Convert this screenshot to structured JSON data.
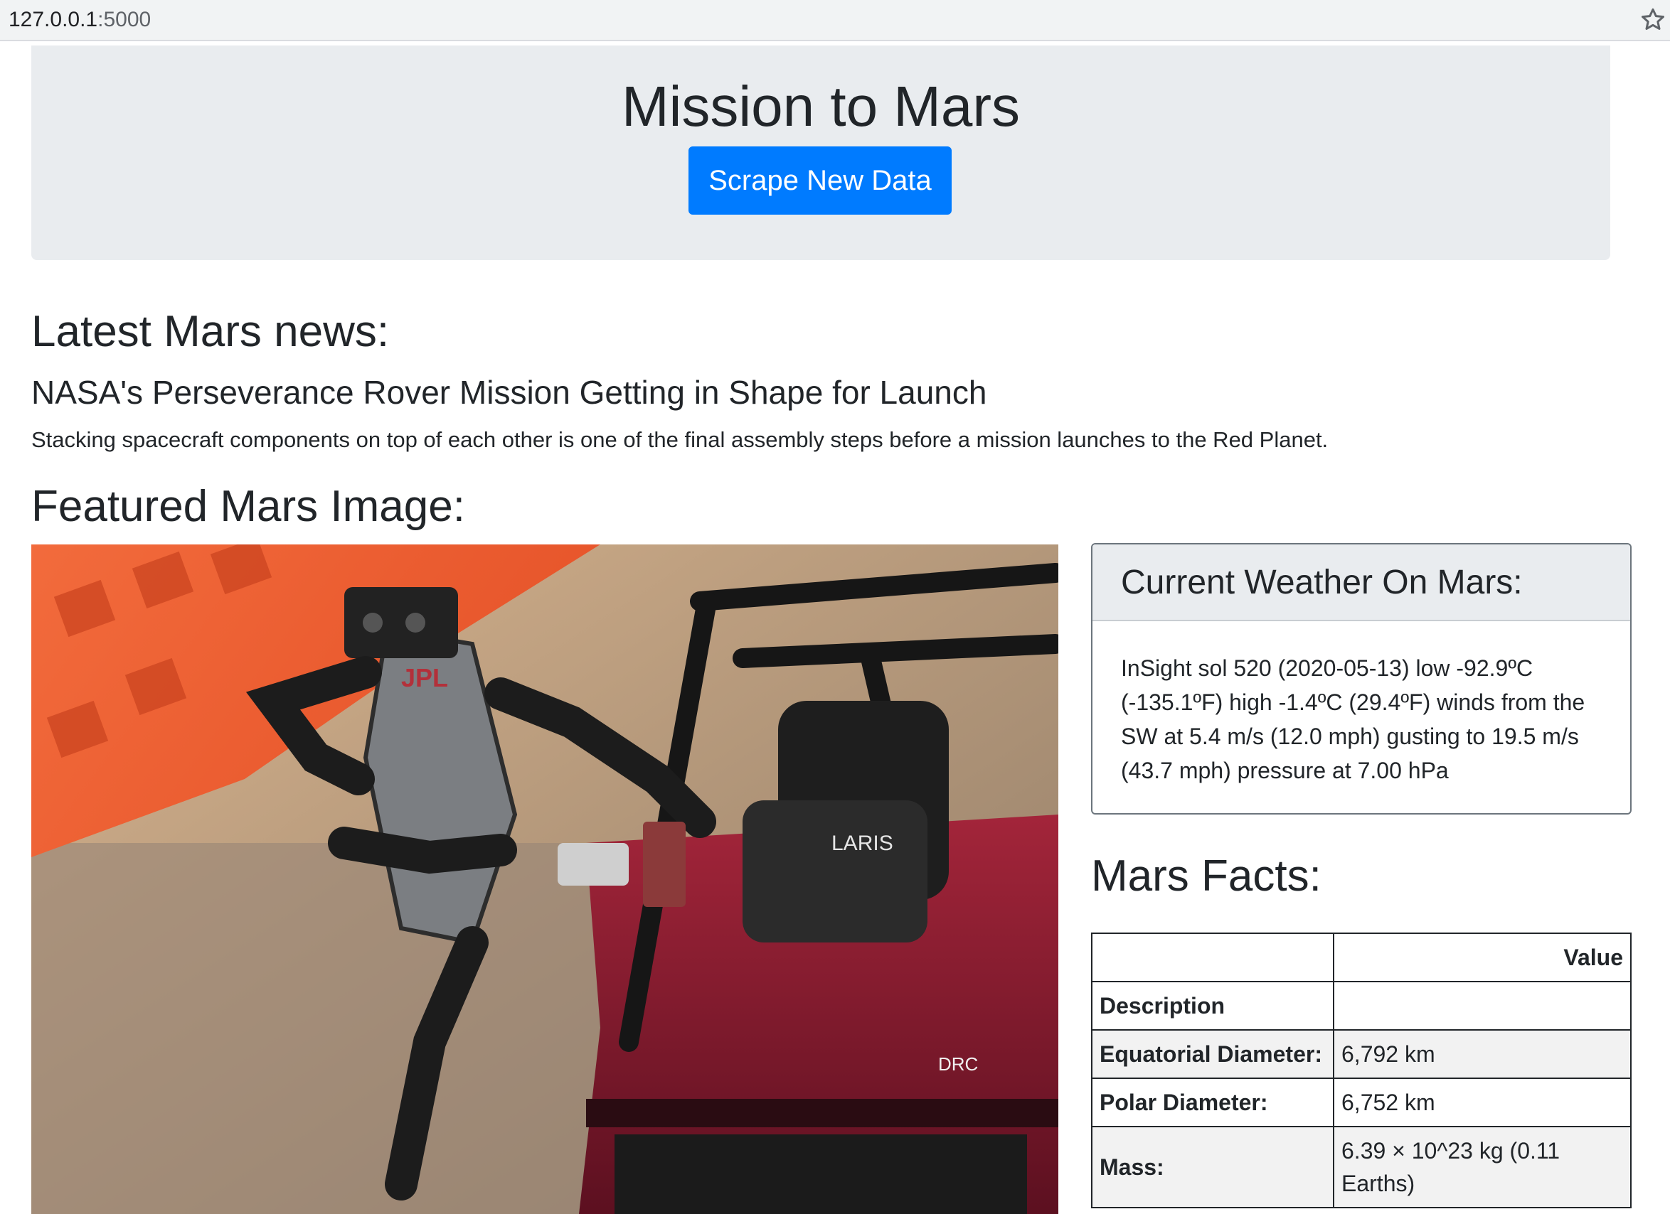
{
  "browser": {
    "url_host": "127.0.0.1",
    "url_port": ":5000"
  },
  "jumbotron": {
    "title": "Mission to Mars",
    "button_label": "Scrape New Data"
  },
  "news": {
    "heading": "Latest Mars news:",
    "title": "NASA's Perseverance Rover Mission Getting in Shape for Launch",
    "paragraph": "Stacking spacecraft components on top of each other is one of the final assembly steps before a mission launches to the Red Planet."
  },
  "featured_image": {
    "heading": "Featured Mars Image:",
    "vehicle_text": "LARIS",
    "logo_text": "JPL",
    "side_text": "DRC"
  },
  "weather": {
    "heading": "Current Weather On Mars:",
    "lines": [
      "InSight sol 520 (2020-05-13) low -92.9ºC",
      "(-135.1ºF) high -1.4ºC (29.4ºF) winds from the",
      "SW at 5.4 m/s (12.0 mph) gusting to 19.5 m/s",
      "(43.7 mph) pressure at 7.00 hPa"
    ]
  },
  "facts": {
    "heading": "Mars Facts:",
    "value_header": "Value",
    "description_label": "Description",
    "rows": [
      {
        "label": "Equatorial Diameter:",
        "value": "6,792 km"
      },
      {
        "label": "Polar Diameter:",
        "value": "6,752 km"
      },
      {
        "label": "Mass:",
        "value": "6.39 × 10^23 kg (0.11 Earths)"
      }
    ]
  },
  "colors": {
    "primary_button": "#007bff",
    "jumbotron_bg": "#e9ecef",
    "text": "#212529"
  },
  "icons": {
    "bookmark": "star-icon"
  }
}
